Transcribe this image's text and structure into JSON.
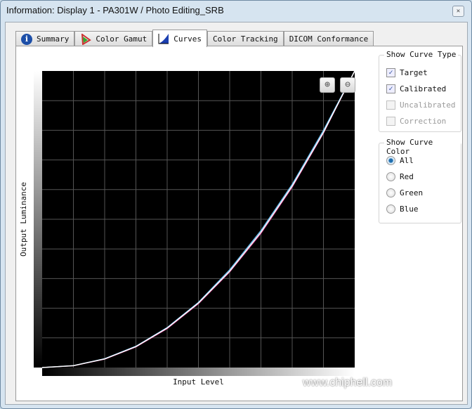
{
  "window": {
    "title": "Information: Display 1 - PA301W / Photo Editing_SRB",
    "close_icon": "close-icon"
  },
  "tabs": [
    {
      "label": "Summary",
      "icon": "info-icon"
    },
    {
      "label": "Color Gamut",
      "icon": "color-gamut-icon"
    },
    {
      "label": "Curves",
      "icon": "curves-icon",
      "active": true
    },
    {
      "label": "Color Tracking"
    },
    {
      "label": "DICOM Conformance"
    }
  ],
  "toolbar": {
    "zoom_in_icon": "zoom-in-icon",
    "zoom_out_icon": "zoom-out-icon"
  },
  "curve_type": {
    "title": "Show Curve Type",
    "options": [
      {
        "label": "Target",
        "checked": true,
        "enabled": true
      },
      {
        "label": "Calibrated",
        "checked": true,
        "enabled": true
      },
      {
        "label": "Uncalibrated",
        "checked": false,
        "enabled": false
      },
      {
        "label": "Correction",
        "checked": false,
        "enabled": false
      }
    ]
  },
  "curve_color": {
    "title": "Show Curve Color",
    "selected": "All",
    "options": [
      "All",
      "Red",
      "Green",
      "Blue"
    ]
  },
  "watermark": "www.chiphell.com",
  "chart_data": {
    "type": "line",
    "xlabel": "Input Level",
    "ylabel": "Output Luminance",
    "xlim": [
      0,
      1
    ],
    "ylim": [
      0,
      1
    ],
    "grid": true,
    "background": "#000000",
    "x": [
      0,
      0.1,
      0.2,
      0.3,
      0.4,
      0.5,
      0.6,
      0.7,
      0.8,
      0.9,
      1
    ],
    "series": [
      {
        "values": [
          0,
          0.0063,
          0.029,
          0.0707,
          0.1332,
          0.2176,
          0.325,
          0.4563,
          0.6121,
          0.7932,
          1
        ],
        "color": "#ffffff"
      },
      {
        "values": [
          0,
          0.0065,
          0.03,
          0.072,
          0.135,
          0.22,
          0.33,
          0.462,
          0.618,
          0.8,
          1
        ],
        "color": "#6ec6ff"
      },
      {
        "values": [
          0,
          0.006,
          0.028,
          0.069,
          0.131,
          0.215,
          0.322,
          0.452,
          0.608,
          0.79,
          1
        ],
        "color": "#d04090"
      }
    ]
  }
}
